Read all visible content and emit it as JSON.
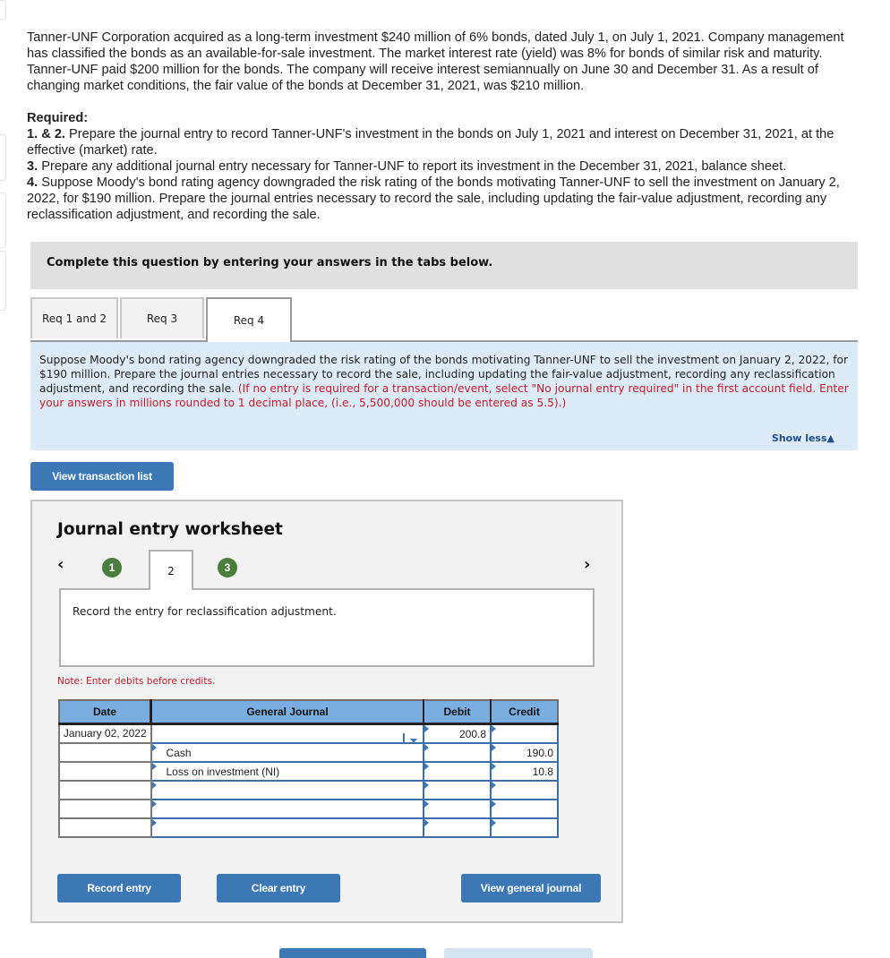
{
  "problem": {
    "intro": "Tanner-UNF Corporation acquired as a long-term investment $240 million of 6% bonds, dated July 1, on July 1, 2021. Company management has classified the bonds as an available-for-sale investment. The market interest rate (yield) was 8% for bonds of similar risk and maturity. Tanner-UNF paid $200 million for the bonds. The company will receive interest semiannually on June 30 and December 31. As a result of changing market conditions, the fair value of the bonds at December 31, 2021, was $210 million.",
    "required_label": "Required:",
    "requirements": [
      {
        "num": "1. & 2.",
        "text": " Prepare the journal entry to record Tanner-UNF's investment in the bonds on July 1, 2021 and interest on December 31, 2021, at the effective (market) rate."
      },
      {
        "num": "3.",
        "text": " Prepare any additional journal entry necessary for Tanner-UNF to report its investment in the December 31, 2021, balance sheet."
      },
      {
        "num": "4.",
        "text": " Suppose Moody's bond rating agency downgraded the risk rating of the bonds motivating Tanner-UNF to sell the investment on January 2, 2022, for $190 million. Prepare the journal entries necessary to record the sale, including updating the fair-value adjustment, recording any reclassification adjustment, and recording the sale."
      }
    ]
  },
  "complete_bar": "Complete this question by entering your answers in the tabs below.",
  "tabs": [
    {
      "label": "Req 1 and 2",
      "active": false
    },
    {
      "label": "Req 3",
      "active": false
    },
    {
      "label": "Req 4",
      "active": true
    }
  ],
  "instructions": {
    "text": "Suppose Moody's bond rating agency downgraded the risk rating of the bonds motivating Tanner-UNF to sell the investment on January 2, 2022, for $190 million. Prepare the journal entries necessary to record the sale, including updating the fair-value adjustment, recording any reclassification adjustment, and recording the sale. ",
    "note_red": "(If no entry is required for a transaction/event, select \"No journal entry required\" in the first account field. Enter your answers in millions rounded to 1 decimal place, (i.e., 5,500,000 should be entered as 5.5).)",
    "show_less": "Show less",
    "show_less_icon": "triangle-up"
  },
  "view_transaction_list": "View transaction list",
  "worksheet": {
    "title": "Journal entry worksheet",
    "prev_icon": "‹",
    "next_icon": "›",
    "steps": [
      {
        "label": "1",
        "completed": true
      },
      {
        "label": "2",
        "active": true
      },
      {
        "label": "3",
        "completed": true
      }
    ],
    "description": "Record the entry for reclassification adjustment.",
    "note": "Note: Enter debits before credits.",
    "columns": {
      "date": "Date",
      "journal": "General Journal",
      "debit": "Debit",
      "credit": "Credit"
    },
    "rows": [
      {
        "date": "January 02, 2022",
        "account": "",
        "debit": "200.8",
        "credit": ""
      },
      {
        "date": "",
        "account": "Cash",
        "debit": "",
        "credit": "190.0"
      },
      {
        "date": "",
        "account": "Loss on investment (NI)",
        "debit": "",
        "credit": "10.8"
      },
      {
        "date": "",
        "account": "",
        "debit": "",
        "credit": ""
      },
      {
        "date": "",
        "account": "",
        "debit": "",
        "credit": ""
      },
      {
        "date": "",
        "account": "",
        "debit": "",
        "credit": ""
      }
    ],
    "buttons": {
      "record": "Record entry",
      "clear": "Clear entry",
      "view_journal": "View general journal"
    }
  },
  "colors": {
    "accent_button": "#3c78b6",
    "step_completed": "#4b7d3f",
    "instruction_bg": "#dcebf7",
    "red_note": "#c0202b",
    "table_header": "#7aade0"
  }
}
